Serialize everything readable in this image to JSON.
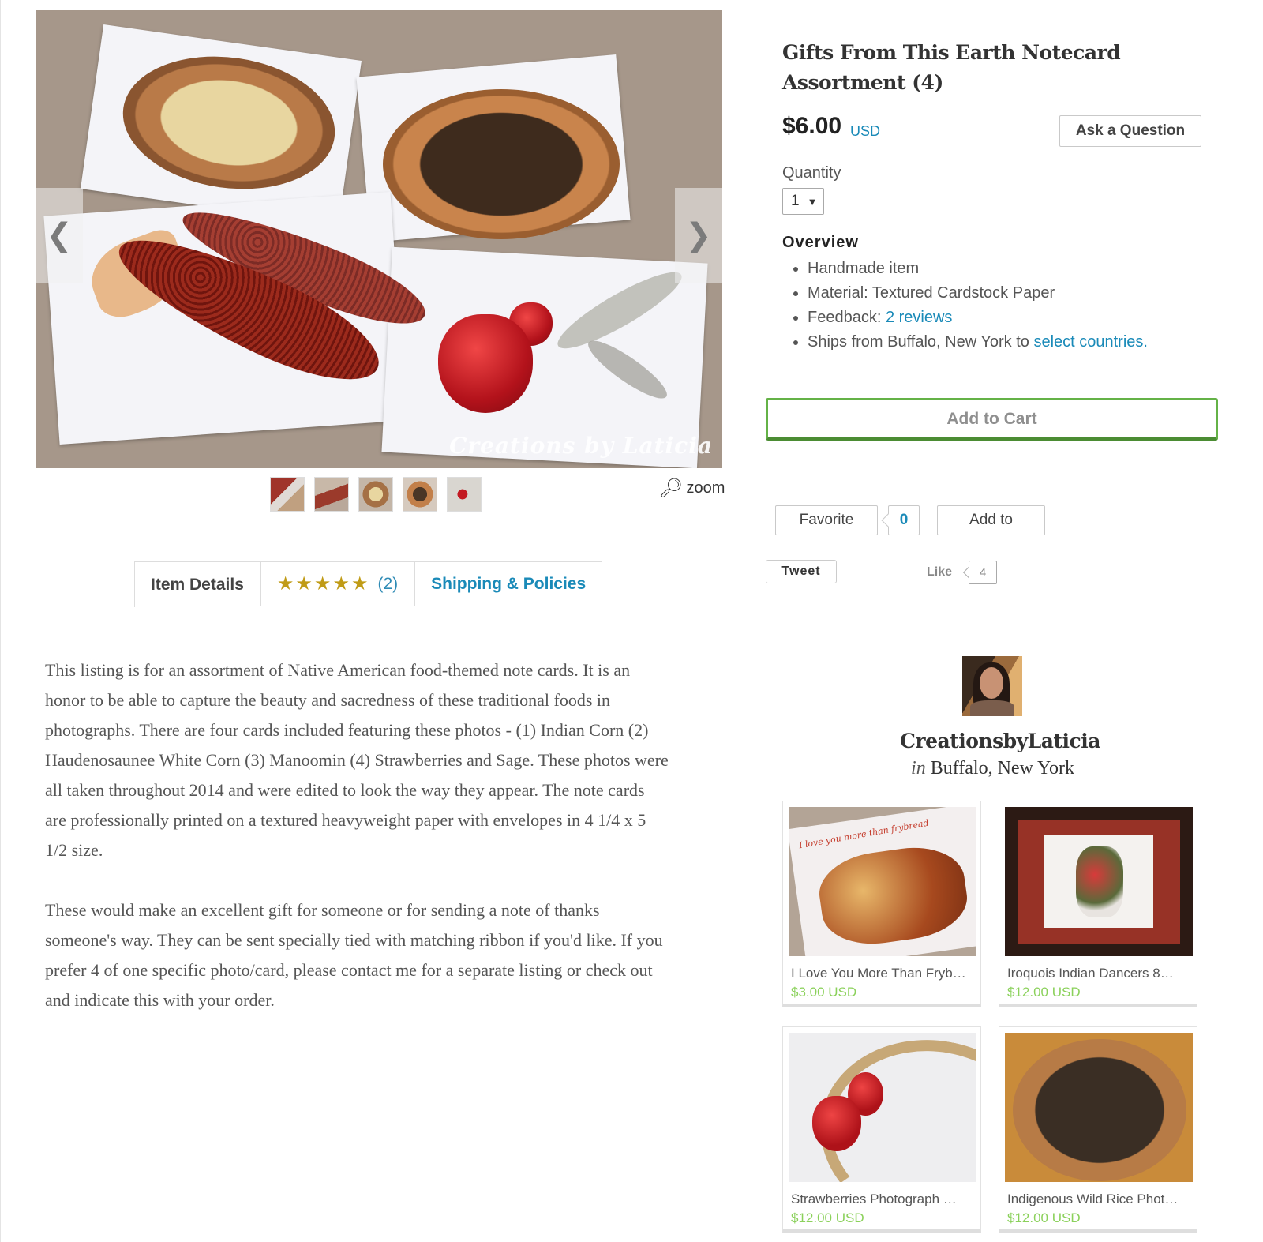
{
  "listing": {
    "title": "Gifts From This Earth Notecard Assortment (4)",
    "price": "$6.00",
    "currency": "USD",
    "ask_question_label": "Ask a Question",
    "quantity_label": "Quantity",
    "quantity_value": "1",
    "overview_title": "Overview",
    "overview": {
      "handmade": "Handmade item",
      "material": "Material: Textured Cardstock Paper",
      "feedback_prefix": "Feedback: ",
      "feedback_link": "2 reviews",
      "ships_prefix": "Ships from Buffalo, New York to ",
      "ships_link": "select countries",
      "ships_suffix": "."
    },
    "add_to_cart_label": "Add to Cart",
    "favorite_label": "Favorite",
    "favorite_count": "0",
    "add_to_label": "Add to",
    "tweet_label": "Tweet",
    "like_label": "Like",
    "like_count": "4"
  },
  "gallery": {
    "watermark": "Creations by Laticia",
    "prev_arrow": "❮",
    "next_arrow": "❯",
    "zoom_label": "zoom",
    "thumbnail_count": 5
  },
  "tabs": {
    "item_details": "Item Details",
    "stars": "★★★★★",
    "review_count": "(2)",
    "shipping": "Shipping & Policies"
  },
  "description": {
    "paragraph1": "This listing is for an assortment of Native American food-themed note cards. It is an honor to be able to capture the beauty and sacredness of these traditional foods in photographs. There are four cards included featuring these photos - (1) Indian Corn (2) Haudenosaunee White Corn (3) Manoomin (4) Strawberries and Sage. These photos were all taken throughout 2014 and were edited to look the way they appear. The note cards are professionally printed on a textured heavyweight paper with envelopes in 4 1/4 x 5 1/2 size.",
    "paragraph2": "These would make an excellent gift for someone or for sending a note of thanks someone's way. They can be sent specially tied with matching ribbon if you'd like. If you prefer 4 of one specific photo/card, please contact me for a separate listing or check out and indicate this with your order."
  },
  "shop": {
    "name": "CreationsbyLaticia",
    "location_prefix": "in",
    "location": "Buffalo, New York",
    "items": [
      {
        "title": "I Love You More Than Fryb…",
        "price": "$3.00 USD",
        "photo_caption": "I love you more than frybread"
      },
      {
        "title": "Iroquois Indian Dancers 8…",
        "price": "$12.00 USD"
      },
      {
        "title": "Strawberries Photograph …",
        "price": "$12.00 USD"
      },
      {
        "title": "Indigenous Wild Rice Phot…",
        "price": "$12.00 USD"
      }
    ]
  },
  "colors": {
    "link": "#1a8ab8",
    "cart_border": "#64b247",
    "price_green": "#8bd15b",
    "star_gold": "#c09b16"
  }
}
